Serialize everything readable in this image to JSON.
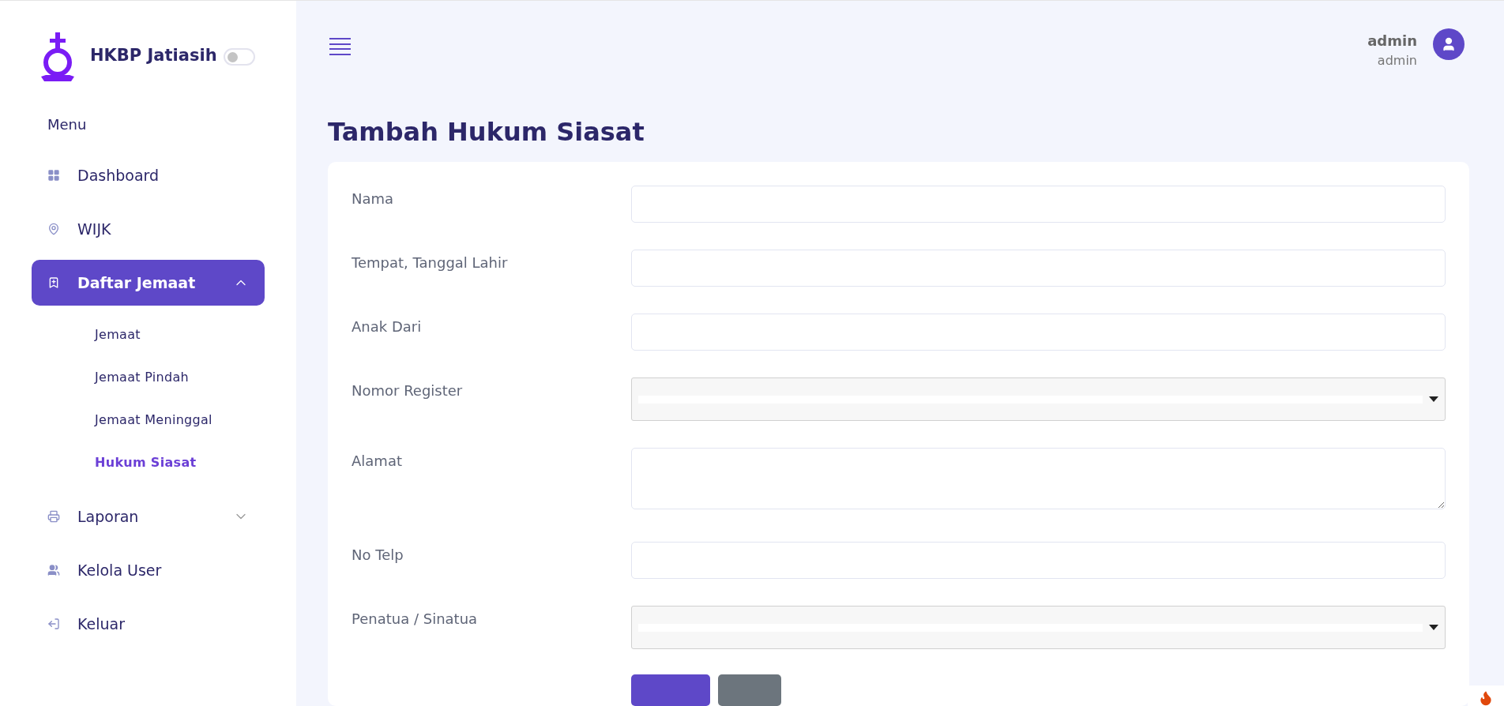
{
  "brand": {
    "name": "HKBP Jatiasih",
    "dark_mode": false
  },
  "sidebar": {
    "heading": "Menu",
    "items": [
      {
        "label": "Dashboard",
        "kind": "grid",
        "selected": false
      },
      {
        "label": "WIJK",
        "kind": "pin",
        "selected": false
      },
      {
        "label": "Daftar Jemaat",
        "kind": "bookmark",
        "selected": true,
        "expanded": true,
        "children": [
          {
            "label": "Jemaat",
            "selected": false
          },
          {
            "label": "Jemaat Pindah",
            "selected": false
          },
          {
            "label": "Jemaat Meninggal",
            "selected": false
          },
          {
            "label": "Hukum Siasat",
            "selected": true
          }
        ]
      },
      {
        "label": "Laporan",
        "kind": "printer",
        "selected": false,
        "expanded": false
      },
      {
        "label": "Kelola User",
        "kind": "users",
        "selected": false
      },
      {
        "label": "Keluar",
        "kind": "logout",
        "selected": false
      }
    ]
  },
  "user": {
    "name": "admin",
    "role": "admin"
  },
  "page_title": "Tambah Hukum Siasat",
  "form": {
    "fields": [
      {
        "label": "Nama",
        "kind": "text"
      },
      {
        "label": "Tempat, Tanggal Lahir",
        "kind": "text"
      },
      {
        "label": "Anak Dari",
        "kind": "text"
      },
      {
        "label": "Nomor Register",
        "kind": "select"
      },
      {
        "label": "Alamat",
        "kind": "textarea"
      },
      {
        "label": "No Telp",
        "kind": "text"
      },
      {
        "label": "Penatua / Sinatua",
        "kind": "select"
      }
    ],
    "buttons": [
      {
        "kind": "primary"
      },
      {
        "kind": "secondary"
      }
    ]
  }
}
